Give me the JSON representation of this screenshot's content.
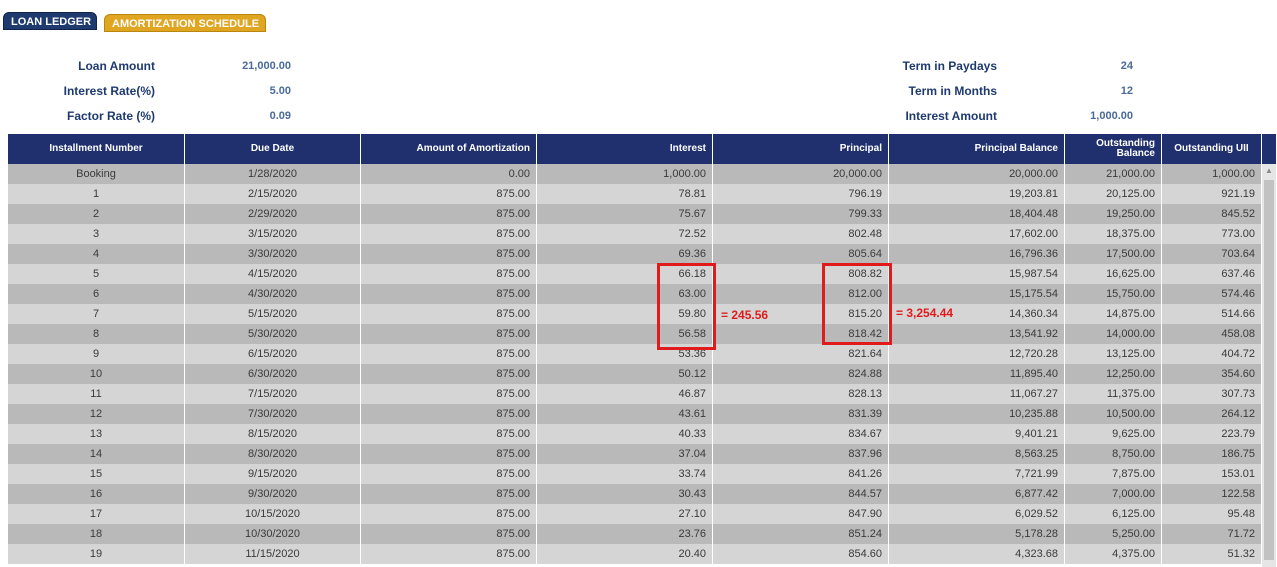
{
  "tabs": {
    "loan_ledger": "LOAN LEDGER",
    "amortization_schedule": "AMORTIZATION SCHEDULE"
  },
  "summary": {
    "loan_amount_label": "Loan Amount",
    "loan_amount": "21,000.00",
    "interest_rate_label": "Interest Rate(%)",
    "interest_rate": "5.00",
    "factor_rate_label": "Factor Rate (%)",
    "factor_rate": "0.09",
    "term_paydays_label": "Term in Paydays",
    "term_paydays": "24",
    "term_months_label": "Term in Months",
    "term_months": "12",
    "interest_amount_label": "Interest Amount",
    "interest_amount": "1,000.00"
  },
  "table": {
    "headers": [
      "Installment Number",
      "Due Date",
      "Amount of Amortization",
      "Interest",
      "Principal",
      "Principal Balance",
      "Outstanding Balance",
      "Outstanding UII"
    ],
    "rows": [
      [
        "Booking",
        "1/28/2020",
        "0.00",
        "1,000.00",
        "20,000.00",
        "20,000.00",
        "21,000.00",
        "1,000.00"
      ],
      [
        "1",
        "2/15/2020",
        "875.00",
        "78.81",
        "796.19",
        "19,203.81",
        "20,125.00",
        "921.19"
      ],
      [
        "2",
        "2/29/2020",
        "875.00",
        "75.67",
        "799.33",
        "18,404.48",
        "19,250.00",
        "845.52"
      ],
      [
        "3",
        "3/15/2020",
        "875.00",
        "72.52",
        "802.48",
        "17,602.00",
        "18,375.00",
        "773.00"
      ],
      [
        "4",
        "3/30/2020",
        "875.00",
        "69.36",
        "805.64",
        "16,796.36",
        "17,500.00",
        "703.64"
      ],
      [
        "5",
        "4/15/2020",
        "875.00",
        "66.18",
        "808.82",
        "15,987.54",
        "16,625.00",
        "637.46"
      ],
      [
        "6",
        "4/30/2020",
        "875.00",
        "63.00",
        "812.00",
        "15,175.54",
        "15,750.00",
        "574.46"
      ],
      [
        "7",
        "5/15/2020",
        "875.00",
        "59.80",
        "815.20",
        "14,360.34",
        "14,875.00",
        "514.66"
      ],
      [
        "8",
        "5/30/2020",
        "875.00",
        "56.58",
        "818.42",
        "13,541.92",
        "14,000.00",
        "458.08"
      ],
      [
        "9",
        "6/15/2020",
        "875.00",
        "53.36",
        "821.64",
        "12,720.28",
        "13,125.00",
        "404.72"
      ],
      [
        "10",
        "6/30/2020",
        "875.00",
        "50.12",
        "824.88",
        "11,895.40",
        "12,250.00",
        "354.60"
      ],
      [
        "11",
        "7/15/2020",
        "875.00",
        "46.87",
        "828.13",
        "11,067.27",
        "11,375.00",
        "307.73"
      ],
      [
        "12",
        "7/30/2020",
        "875.00",
        "43.61",
        "831.39",
        "10,235.88",
        "10,500.00",
        "264.12"
      ],
      [
        "13",
        "8/15/2020",
        "875.00",
        "40.33",
        "834.67",
        "9,401.21",
        "9,625.00",
        "223.79"
      ],
      [
        "14",
        "8/30/2020",
        "875.00",
        "37.04",
        "837.96",
        "8,563.25",
        "8,750.00",
        "186.75"
      ],
      [
        "15",
        "9/15/2020",
        "875.00",
        "33.74",
        "841.26",
        "7,721.99",
        "7,875.00",
        "153.01"
      ],
      [
        "16",
        "9/30/2020",
        "875.00",
        "30.43",
        "844.57",
        "6,877.42",
        "7,000.00",
        "122.58"
      ],
      [
        "17",
        "10/15/2020",
        "875.00",
        "27.10",
        "847.90",
        "6,029.52",
        "6,125.00",
        "95.48"
      ],
      [
        "18",
        "10/30/2020",
        "875.00",
        "23.76",
        "851.24",
        "5,178.28",
        "5,250.00",
        "71.72"
      ],
      [
        "19",
        "11/15/2020",
        "875.00",
        "20.40",
        "854.60",
        "4,323.68",
        "4,375.00",
        "51.32"
      ]
    ]
  },
  "annotations": {
    "interest_sum": "= 245.56",
    "principal_sum": "= 3,254.44"
  },
  "colors": {
    "header_bg": "#20306f",
    "annotation": "#e01b1b",
    "tab_active": "#e0a521",
    "tab_inactive": "#1e3a6e"
  }
}
